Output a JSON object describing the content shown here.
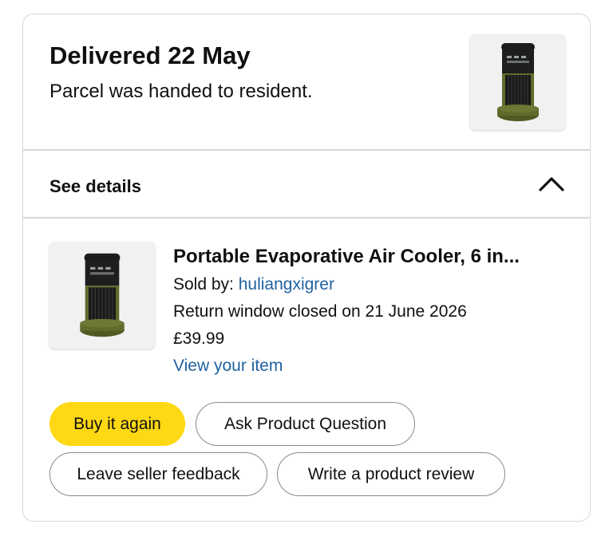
{
  "delivery": {
    "status_title": "Delivered 22 May",
    "status_detail": "Parcel was handed to resident."
  },
  "details": {
    "label": "See details",
    "chevron_icon": "chevron-up-icon"
  },
  "item": {
    "title": "Portable Evaporative Air Cooler, 6 in...",
    "sold_by_prefix": "Sold by: ",
    "seller_name": "huliangxigrer",
    "return_window": "Return window closed on 21 June 2026",
    "price": "£39.99",
    "view_item_label": "View your item",
    "image_icon": "air-cooler-product-image"
  },
  "actions": {
    "buy_again": "Buy it again",
    "ask_question": "Ask Product Question",
    "seller_feedback": "Leave seller feedback",
    "product_review": "Write a product review"
  },
  "colors": {
    "primary_button": "#ffd814",
    "link": "#2162a1",
    "border": "#d5d9d9",
    "text": "#0f1111",
    "product_green": "#5f6b2b"
  }
}
